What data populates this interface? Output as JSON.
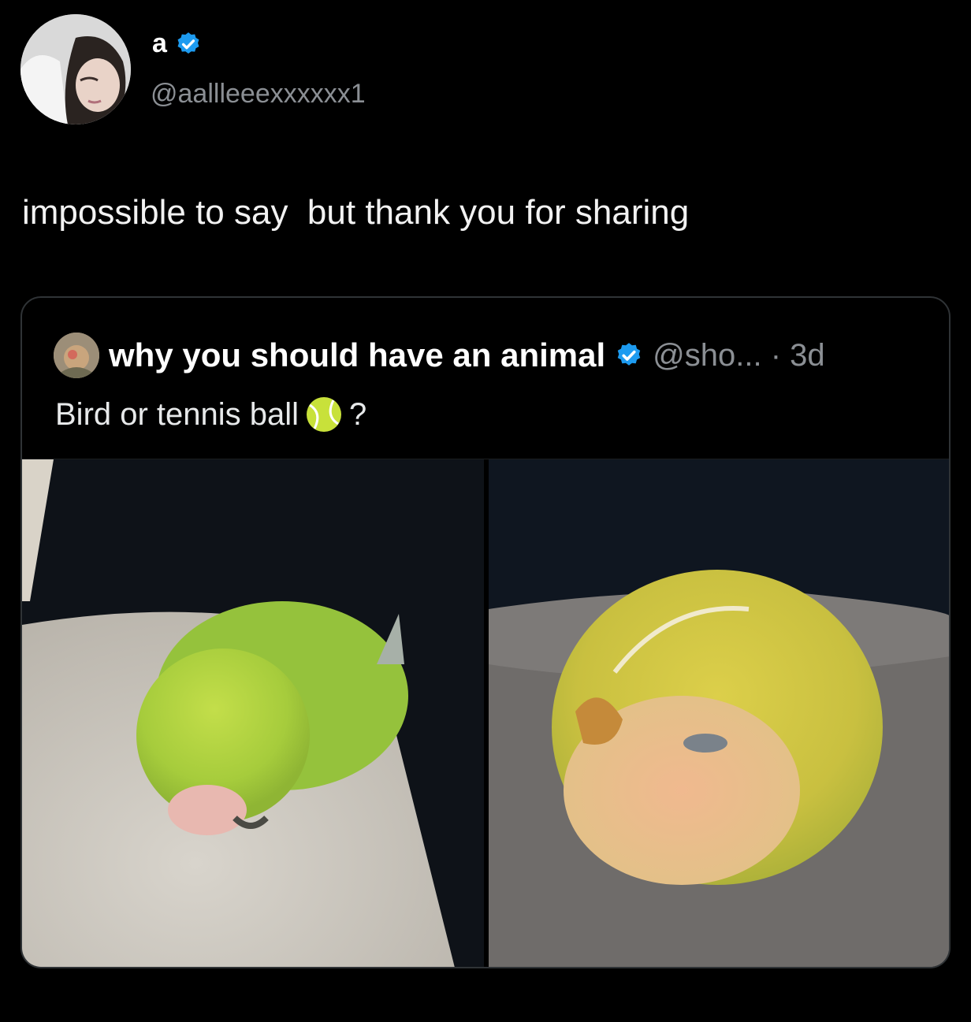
{
  "tweet": {
    "author_name": "a",
    "author_handle": "@aallleeexxxxxx1",
    "verified_icon": "verified-badge-icon",
    "text": "impossible to say  but thank you for sharing"
  },
  "quoted_tweet": {
    "author_name": "why you should have an animal",
    "author_handle_time": "@sho... · 3d",
    "text_before_emoji": "Bird or tennis ball",
    "emoji": "tennis-ball-icon",
    "text_after_emoji": "?",
    "media": [
      "bird-photo-left",
      "bird-photo-right"
    ]
  },
  "colors": {
    "background": "#000000",
    "verified_blue": "#1d9bf0",
    "muted_text": "#8b8f94",
    "card_border": "#2f3336"
  }
}
